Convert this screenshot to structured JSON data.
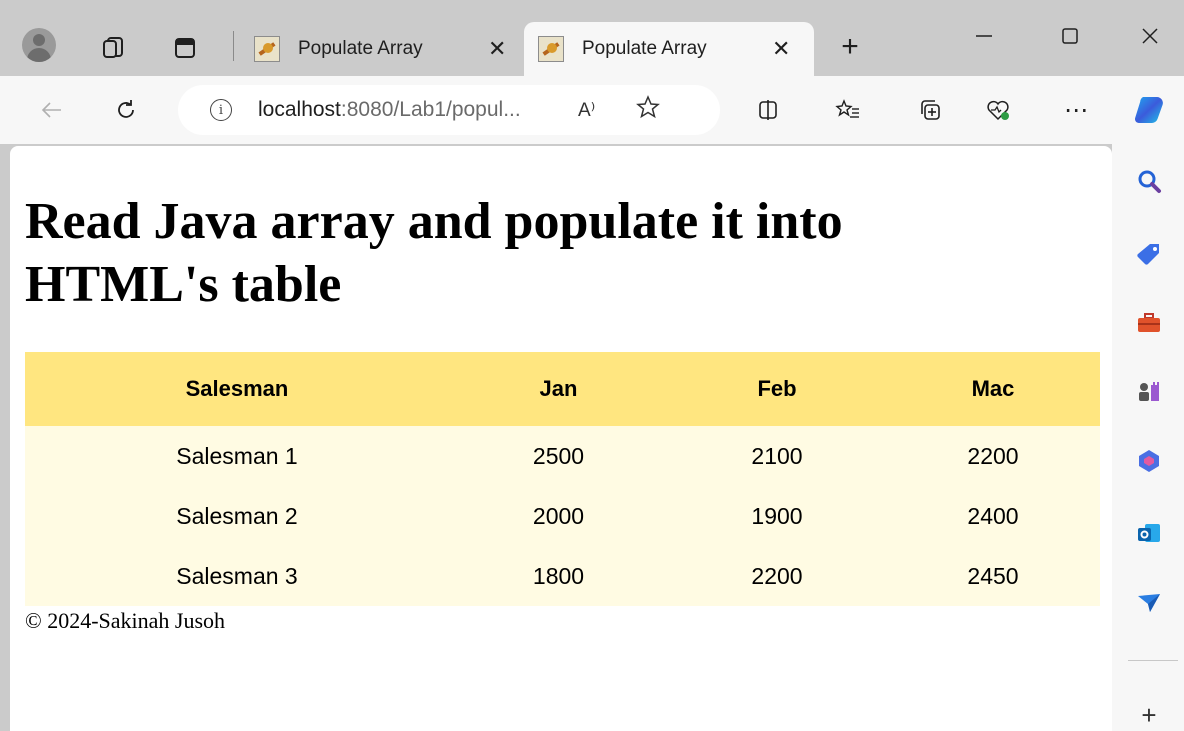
{
  "browser": {
    "tabs": [
      {
        "title": "Populate Array",
        "close": "✕",
        "active": false
      },
      {
        "title": "Populate Array",
        "close": "✕",
        "active": true
      }
    ],
    "new_tab": "+",
    "address": {
      "host": "localhost",
      "rest": ":8080/Lab1/popul...",
      "read_aloud": "A⁾"
    },
    "more": "⋯",
    "sidebar_add": "+"
  },
  "page": {
    "heading": "Read Java array and populate it into HTML's table",
    "table": {
      "headers": [
        "Salesman",
        "Jan",
        "Feb",
        "Mac"
      ],
      "rows": [
        [
          "Salesman 1",
          "2500",
          "2100",
          "2200"
        ],
        [
          "Salesman 2",
          "2000",
          "1900",
          "2400"
        ],
        [
          "Salesman 3",
          "1800",
          "2200",
          "2450"
        ]
      ]
    },
    "footer": "© 2024-Sakinah Jusoh"
  },
  "colors": {
    "header_row": "#ffe680",
    "body_row": "#fffbe3",
    "chrome": "#cbcbcb"
  }
}
